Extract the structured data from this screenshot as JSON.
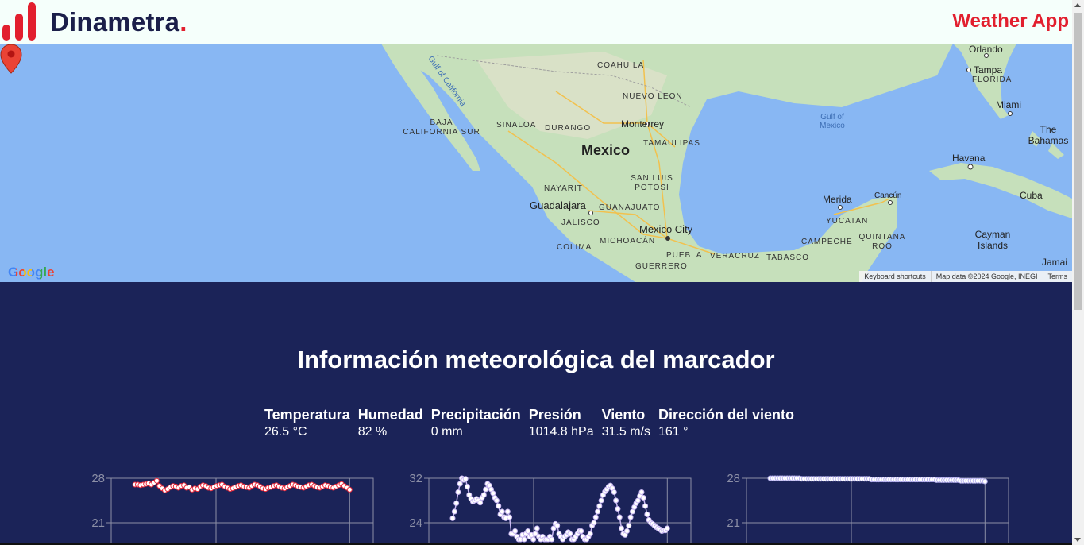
{
  "header": {
    "brand_name": "Dinametra",
    "brand_dot": ".",
    "app_title": "Weather App",
    "brand_color": "#e21f2e"
  },
  "map": {
    "labels": {
      "mexico": "Mexico",
      "mexico_city": "Mexico City",
      "guadalajara": "Guadalajara",
      "monterrey": "Monterrey",
      "merida": "Merida",
      "cancun": "Cancún",
      "havana": "Havana",
      "cuba": "Cuba",
      "miami": "Miami",
      "tampa": "Tampa",
      "orlando": "Orlando",
      "florida": "FLORIDA",
      "bahamas": "The Bahamas",
      "cayman": "Cayman Islands",
      "jamaica": "Jamai",
      "gulf_mexico": "Gulf of Mexico",
      "gulf_california": "Gulf of California",
      "coahuila": "COAHUILA",
      "nuevo_leon": "NUEVO LEON",
      "baja": "BAJA CALIFORNIA SUR",
      "sinaloa": "SINALOA",
      "durango": "DURANGO",
      "tamaulipas": "TAMAULIPAS",
      "nayarit": "NAYARIT",
      "slp": "SAN LUIS POTOSI",
      "guanajuato": "GUANAJUATO",
      "jalisco": "JALISCO",
      "michoacan": "MICHOACÁN",
      "colima": "COLIMA",
      "puebla": "PUEBLA",
      "veracruz": "VERACRUZ",
      "tabasco": "TABASCO",
      "campeche": "CAMPECHE",
      "quintana": "QUINTANA ROO",
      "yucatan": "YUCATAN",
      "guerrero": "GUERRERO"
    },
    "google_logo": "Google",
    "attribution": {
      "shortcuts": "Keyboard shortcuts",
      "data": "Map data ©2024 Google, INEGI",
      "terms": "Terms"
    }
  },
  "weather": {
    "title": "Información meteorológica del marcador",
    "columns": [
      {
        "header": "Temperatura",
        "value": "26.5 °C"
      },
      {
        "header": "Humedad",
        "value": "82 %"
      },
      {
        "header": "Precipitación",
        "value": "0 mm"
      },
      {
        "header": "Presión",
        "value": "1014.8 hPa"
      },
      {
        "header": "Viento",
        "value": "31.5 m/s"
      },
      {
        "header": "Dirección del viento",
        "value": "161 °"
      }
    ]
  },
  "chart_data": [
    {
      "type": "line",
      "yticks": [
        "28",
        "21"
      ],
      "ylim": [
        14,
        28
      ],
      "color": "#e8283a",
      "values": [
        27.0,
        27.0,
        26.9,
        27.0,
        27.1,
        27.2,
        27.0,
        27.3,
        27.6,
        26.8,
        26.4,
        26.1,
        26.3,
        26.6,
        26.8,
        26.7,
        26.5,
        26.8,
        26.9,
        26.5,
        26.6,
        26.2,
        26.4,
        26.3,
        26.7,
        26.9,
        26.8,
        26.5,
        26.4,
        26.6,
        26.8,
        26.9,
        27.0,
        26.7,
        26.5,
        26.3,
        26.4,
        26.6,
        26.8,
        26.9,
        26.7,
        26.6,
        26.5,
        26.8,
        27.0,
        26.9,
        26.7,
        26.4,
        26.3,
        26.5,
        26.6,
        26.8,
        26.9,
        26.7,
        26.5,
        26.4,
        26.6,
        26.8,
        27.0,
        26.9,
        26.7,
        26.6,
        26.5,
        26.7,
        26.9,
        27.0,
        26.8,
        26.6,
        26.5,
        26.7,
        26.9,
        26.8,
        26.6,
        26.5,
        26.7,
        26.9,
        27.1,
        26.8,
        26.5,
        26.2
      ]
    },
    {
      "type": "line",
      "yticks": [
        "32",
        "24"
      ],
      "ylim": [
        16,
        32
      ],
      "color": "#c9b8f2",
      "values": [
        24.8,
        26.0,
        27.5,
        29.5,
        31.0,
        32.0,
        31.7,
        31.9,
        30.5,
        29.0,
        28.3,
        27.8,
        28.0,
        28.3,
        28.0,
        27.6,
        28.5,
        29.0,
        30.0,
        31.0,
        30.7,
        30.0,
        29.3,
        28.5,
        28.0,
        27.0,
        25.5,
        26.0,
        25.0,
        24.8,
        26.0,
        25.0,
        22.0,
        22.0,
        22.5,
        21.5,
        21.0,
        21.0,
        21.8,
        21.0,
        22.0,
        22.5,
        21.5,
        21.8,
        21.0,
        22.0,
        23.0,
        21.5,
        21.0,
        21.5,
        21.0,
        21.0,
        21.0,
        21.5,
        21.0,
        23.0,
        23.8,
        23.5,
        22.0,
        21.5,
        21.0,
        21.5,
        21.8,
        22.3,
        22.0,
        21.0,
        21.0,
        21.5,
        22.0,
        22.5,
        22.5,
        21.5,
        21.0,
        21.0,
        21.5,
        22.0,
        23.5,
        24.0,
        25.0,
        26.0,
        27.0,
        28.0,
        29.0,
        29.6,
        30.0,
        30.5,
        30.7,
        30.2,
        29.5,
        28.0,
        26.5,
        25.0,
        23.0,
        22.0,
        21.8,
        22.5,
        23.5,
        25.0,
        26.0,
        26.8,
        27.5,
        28.0,
        28.8,
        29.5,
        28.5,
        27.0,
        25.5,
        24.5,
        24.0,
        23.8,
        23.5,
        23.2,
        23.0,
        22.8,
        22.5,
        22.6,
        22.6,
        23.0
      ]
    },
    {
      "type": "line",
      "yticks": [
        "28",
        "21"
      ],
      "ylim": [
        14,
        28
      ],
      "color": "#b7b2ee",
      "values": [
        28.0,
        28.0,
        28.0,
        28.0,
        28.0,
        28.0,
        28.0,
        28.0,
        28.0,
        28.0,
        28.0,
        28.0,
        28.0,
        27.9,
        27.9,
        27.9,
        27.9,
        27.9,
        27.9,
        27.9,
        27.9,
        27.9,
        27.9,
        27.9,
        27.9,
        27.9,
        27.9,
        27.9,
        27.9,
        27.9,
        27.9,
        27.9,
        27.9,
        27.9,
        27.9,
        27.9,
        27.9,
        27.9,
        27.9,
        27.9,
        27.9,
        27.9,
        27.8,
        27.8,
        27.8,
        27.8,
        27.8,
        27.8,
        27.8,
        27.8,
        27.8,
        27.8,
        27.8,
        27.8,
        27.8,
        27.8,
        27.8,
        27.8,
        27.8,
        27.8,
        27.8,
        27.8,
        27.8,
        27.8,
        27.8,
        27.8,
        27.8,
        27.8,
        27.8,
        27.7,
        27.7,
        27.7,
        27.7,
        27.7,
        27.7,
        27.7,
        27.7,
        27.7,
        27.7,
        27.6,
        27.6,
        27.6,
        27.6,
        27.6,
        27.6,
        27.6,
        27.6,
        27.6,
        27.6,
        27.5
      ]
    }
  ]
}
